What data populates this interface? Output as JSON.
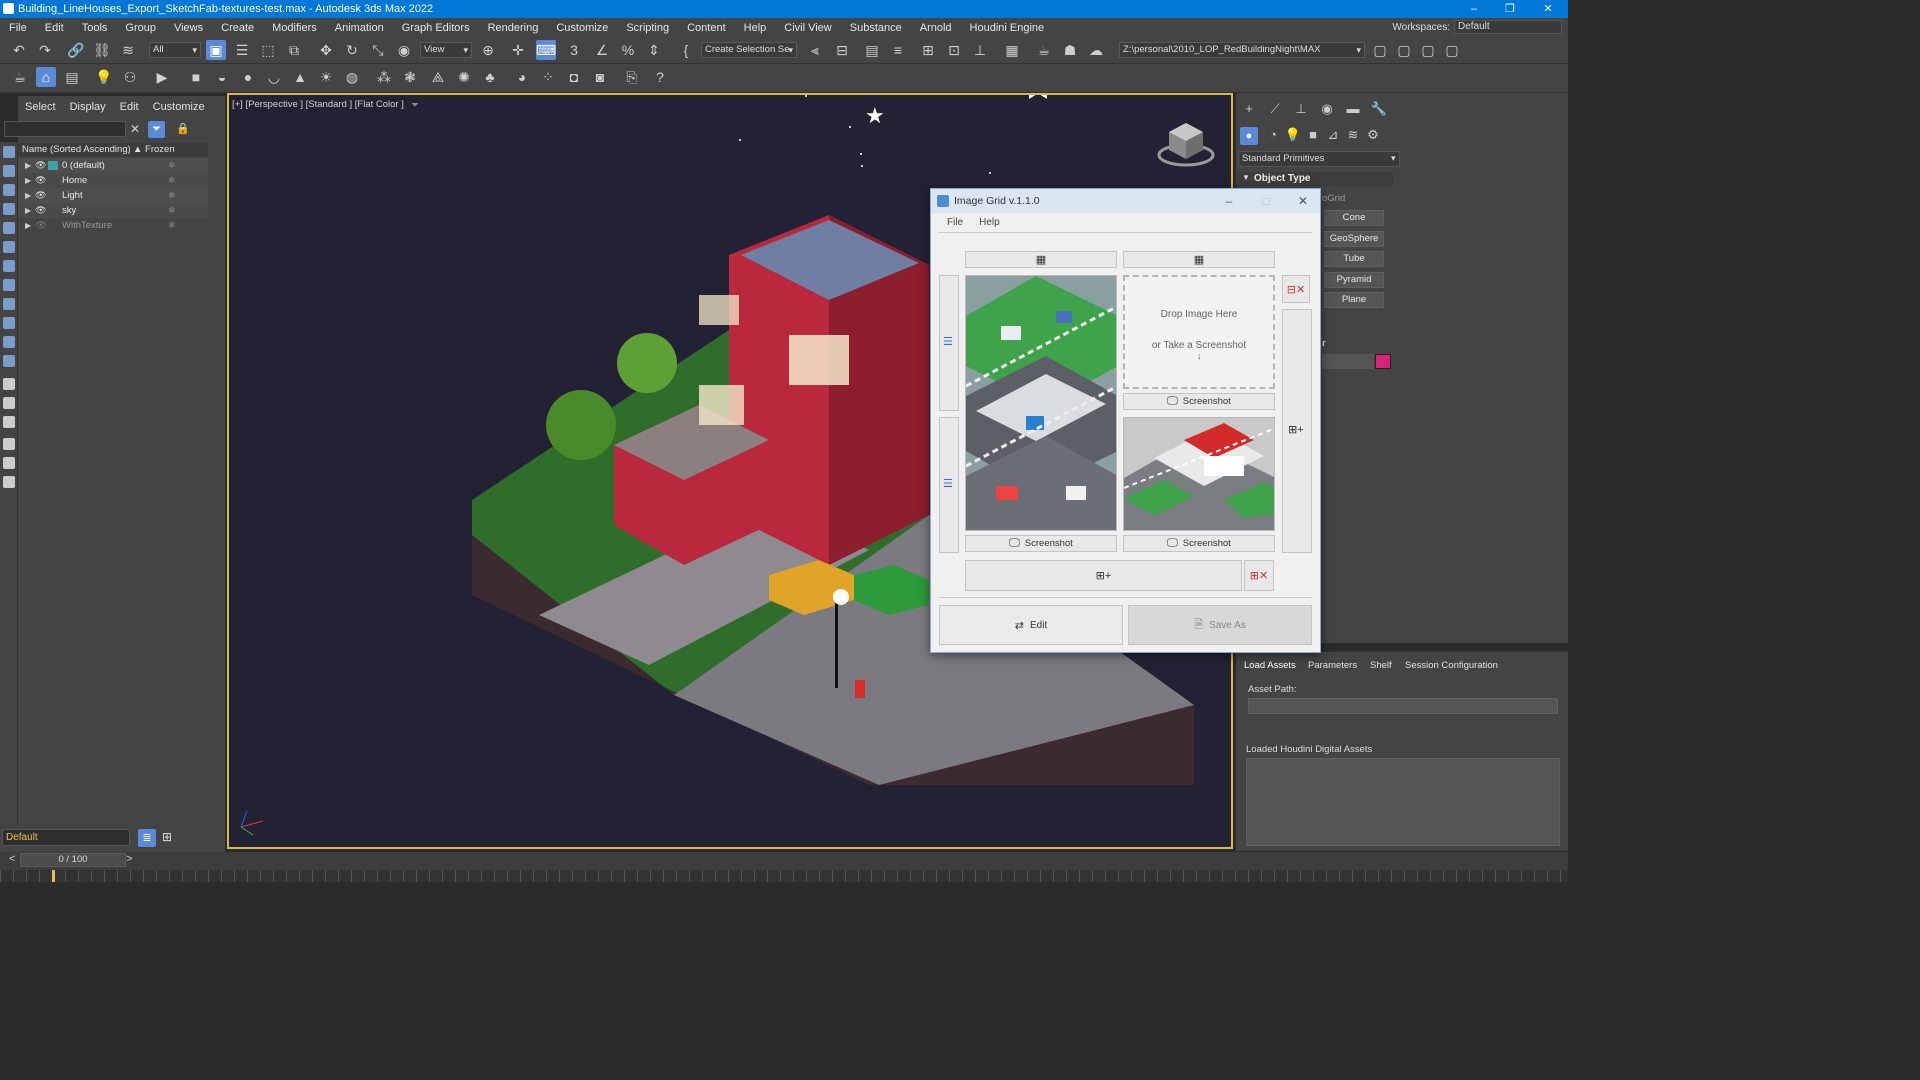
{
  "window": {
    "title": "Building_LineHouses_Export_SketchFab-textures-test.max - Autodesk 3ds Max 2022"
  },
  "menu": [
    "File",
    "Edit",
    "Tools",
    "Group",
    "Views",
    "Create",
    "Modifiers",
    "Animation",
    "Graph Editors",
    "Rendering",
    "Customize",
    "Scripting",
    "Content",
    "Help",
    "Civil View",
    "Substance",
    "Arnold",
    "Houdini Engine"
  ],
  "workspace": {
    "label": "Workspaces:",
    "value": "Default"
  },
  "toolbar": {
    "filter_value": "All",
    "view_value": "View",
    "selection_set_placeholder": "Create Selection Se",
    "project_path": "Z:\\personal\\2010_LOP_RedBuildingNight\\MAX"
  },
  "explorer": {
    "menu": [
      "Select",
      "Display",
      "Edit",
      "Customize"
    ],
    "col_name": "Name (Sorted Ascending)",
    "col_frozen": "▲ Frozen",
    "rows": [
      {
        "label": "0 (default)"
      },
      {
        "label": "Home"
      },
      {
        "label": "Light"
      },
      {
        "label": "sky"
      },
      {
        "label": "WithTexture"
      }
    ],
    "layer": "Default"
  },
  "viewport": {
    "label": "[+] [Perspective ] [Standard ] [Flat Color ]"
  },
  "command_panel": {
    "category": "Standard Primitives",
    "object_type": "Object Type",
    "autogrid_fragment": "oGrid",
    "buttons": [
      "Cone",
      "GeoSphere",
      "Tube",
      "Pyramid",
      "Plane"
    ],
    "name_fragment": "r",
    "swatch_color": "#d6247a"
  },
  "houdini": {
    "tabs": [
      "Load Assets",
      "Parameters",
      "Shelf",
      "Session Configuration"
    ],
    "asset_path_label": "Asset Path:",
    "loaded_label": "Loaded Houdini Digital Assets"
  },
  "timeline": {
    "frame": "0 / 100",
    "left_arrow": "<",
    "right_arrow": ">"
  },
  "dialog": {
    "title": "Image Grid v.1.1.0",
    "menu": [
      "File",
      "Help"
    ],
    "drop_line1": "Drop Image Here",
    "drop_line2": "or Take a Screenshot",
    "screenshot_label": "Screenshot",
    "edit_label": "Edit",
    "saveas_label": "Save As"
  },
  "colors": {
    "accent": "#0078d7",
    "viewport_border": "#d9b84a",
    "viewport_bg": "#232235"
  }
}
